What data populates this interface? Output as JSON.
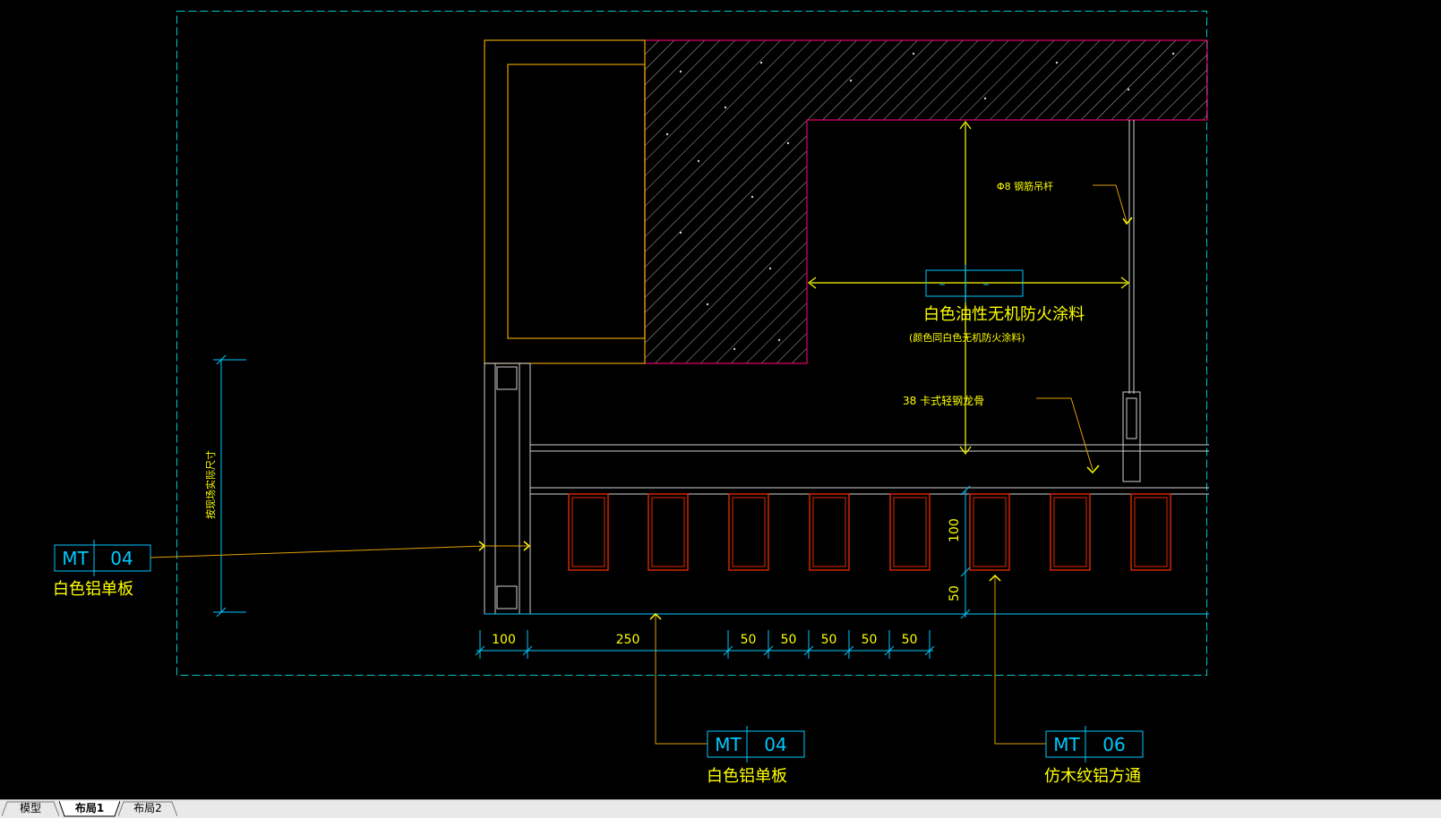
{
  "labels": {
    "fire_coating": "白色油性无机防火涂料",
    "fire_coating_sub": "(颜色同白色无机防火涂料)",
    "rod": "Φ8 钢筋吊杆",
    "keel": "38 卡式轻钢龙骨",
    "vertical_dim_note": "按现场实际尺寸",
    "material_left": "白色铝单板",
    "material_bottom_mid": "白色铝单板",
    "material_bottom_right": "仿木纹铝方通"
  },
  "tags": {
    "left": {
      "code": "MT",
      "num": "04"
    },
    "mid": {
      "code": "MT",
      "num": "04"
    },
    "right": {
      "code": "MT",
      "num": "06"
    },
    "center": {
      "code": "–",
      "num": "–"
    }
  },
  "dimensions": {
    "h": [
      "100",
      "250",
      "50",
      "50",
      "50",
      "50",
      "50"
    ],
    "v_100": "100",
    "v_50": "50"
  },
  "tabs": [
    {
      "label": "模型",
      "active": false
    },
    {
      "label": "布局1",
      "active": true
    },
    {
      "label": "布局2",
      "active": false
    }
  ],
  "colors": {
    "background": "#000000",
    "viewport_border": "#00c8c8",
    "concrete": "#e0006a",
    "frame": "#e0a000",
    "slats": "#e02800",
    "dimension": "#00c8ff",
    "annotation": "#ffff00",
    "leader": "#e0a000"
  }
}
